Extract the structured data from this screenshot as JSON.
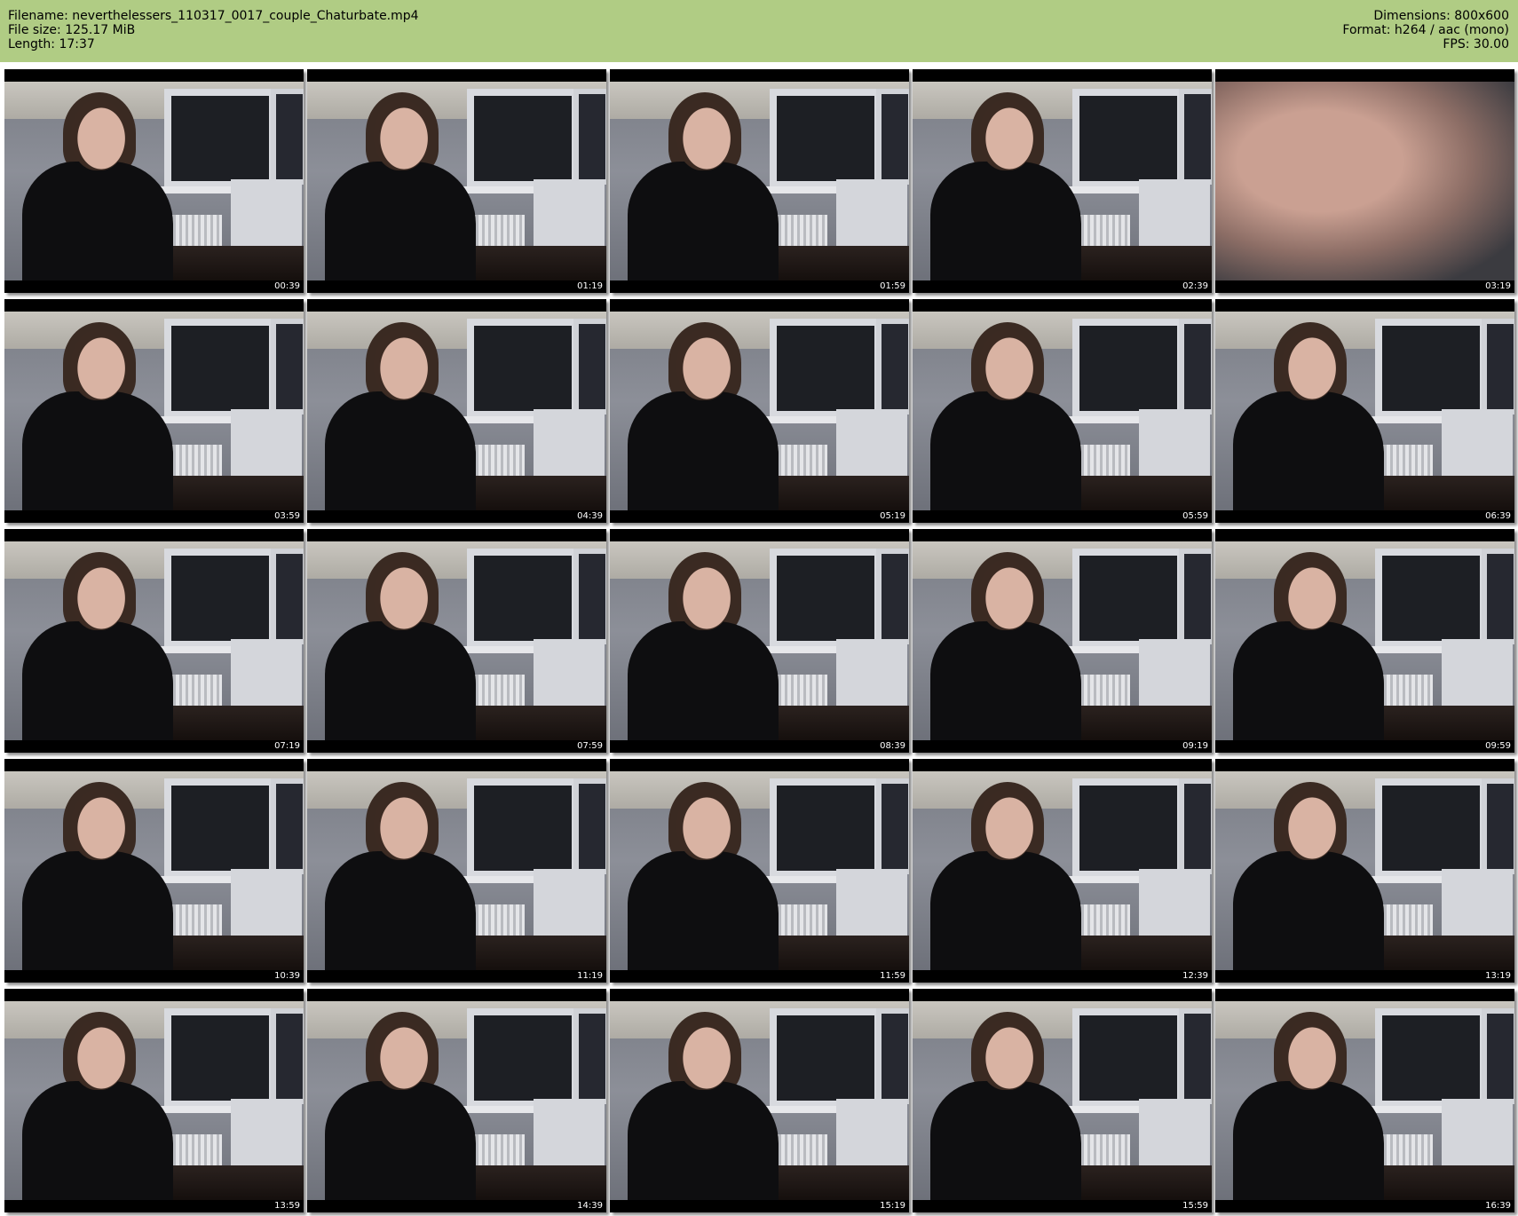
{
  "header": {
    "filename": "Filename: neverthelessers_110317_0017_couple_Chaturbate.mp4",
    "filesize": "File size: 125.17 MiB",
    "length": "Length: 17:37",
    "dimensions": "Dimensions: 800x600",
    "format": "Format: h264 / aac (mono)",
    "fps": "FPS: 30.00"
  },
  "thumbnails": [
    {
      "time": "00:39"
    },
    {
      "time": "01:19"
    },
    {
      "time": "01:59"
    },
    {
      "time": "02:39"
    },
    {
      "time": "03:19"
    },
    {
      "time": "03:59"
    },
    {
      "time": "04:39"
    },
    {
      "time": "05:19"
    },
    {
      "time": "05:59"
    },
    {
      "time": "06:39"
    },
    {
      "time": "07:19"
    },
    {
      "time": "07:59"
    },
    {
      "time": "08:39"
    },
    {
      "time": "09:19"
    },
    {
      "time": "09:59"
    },
    {
      "time": "10:39"
    },
    {
      "time": "11:19"
    },
    {
      "time": "11:59"
    },
    {
      "time": "12:39"
    },
    {
      "time": "13:19"
    },
    {
      "time": "13:59"
    },
    {
      "time": "14:39"
    },
    {
      "time": "15:19"
    },
    {
      "time": "15:59"
    },
    {
      "time": "16:39"
    }
  ],
  "colors": {
    "header_background": "#b0cc84",
    "page_background": "#ffffff",
    "timestamp_text": "#ffffff"
  }
}
